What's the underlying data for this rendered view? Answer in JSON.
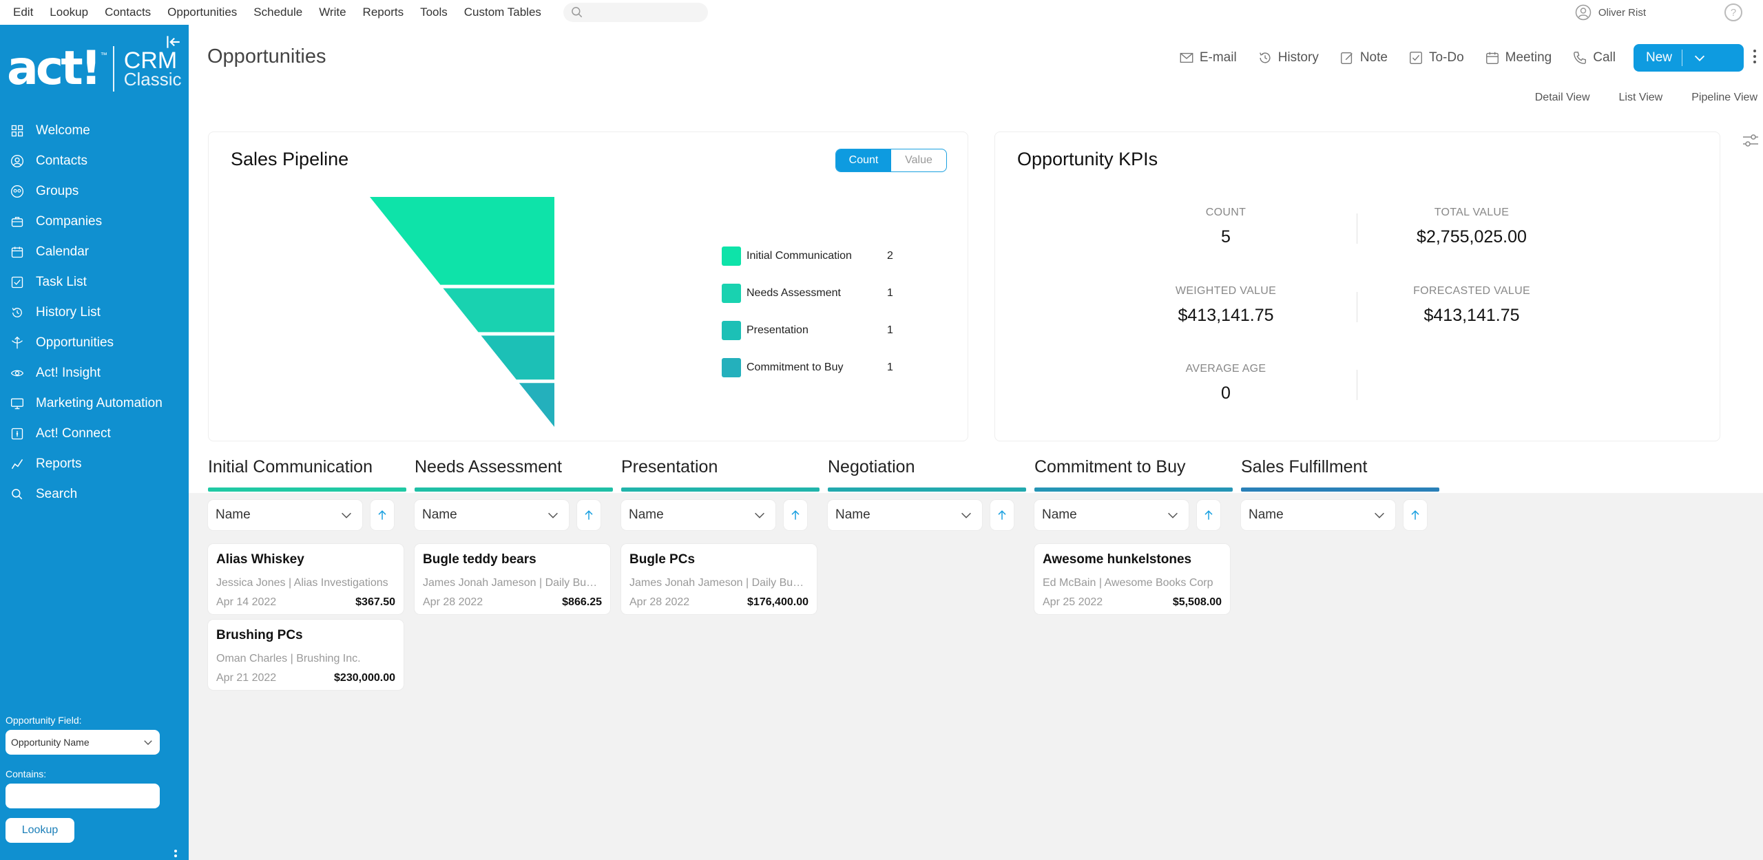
{
  "menubar": {
    "items": [
      "Edit",
      "Lookup",
      "Contacts",
      "Opportunities",
      "Schedule",
      "Write",
      "Reports",
      "Tools",
      "Custom Tables"
    ],
    "user_name": "Oliver Rist",
    "help_glyph": "?"
  },
  "sidebar": {
    "logo": {
      "brand": "act!",
      "tm": "™",
      "crm": "CRM",
      "classic": "Classic"
    },
    "items": [
      {
        "label": "Welcome",
        "icon": "grid-icon"
      },
      {
        "label": "Contacts",
        "icon": "contact-icon"
      },
      {
        "label": "Groups",
        "icon": "groups-icon"
      },
      {
        "label": "Companies",
        "icon": "briefcase-icon"
      },
      {
        "label": "Calendar",
        "icon": "calendar-icon"
      },
      {
        "label": "Task List",
        "icon": "checkbox-icon"
      },
      {
        "label": "History List",
        "icon": "history-icon"
      },
      {
        "label": "Opportunities",
        "icon": "opportunity-icon"
      },
      {
        "label": "Act! Insight",
        "icon": "eye-icon"
      },
      {
        "label": "Marketing Automation",
        "icon": "monitor-icon"
      },
      {
        "label": "Act! Connect",
        "icon": "connect-icon"
      },
      {
        "label": "Reports",
        "icon": "reports-icon"
      },
      {
        "label": "Search",
        "icon": "search-icon"
      }
    ],
    "lookup": {
      "field_label": "Opportunity Field:",
      "field_value": "Opportunity Name",
      "contains_label": "Contains:",
      "contains_value": "",
      "button_label": "Lookup"
    }
  },
  "header": {
    "title": "Opportunities",
    "actions": {
      "email": "E-mail",
      "history": "History",
      "note": "Note",
      "todo": "To-Do",
      "meeting": "Meeting",
      "call": "Call"
    },
    "new_label": "New",
    "views": {
      "detail": "Detail View",
      "list": "List View",
      "pipeline": "Pipeline View"
    }
  },
  "pipeline_card": {
    "title": "Sales Pipeline",
    "toggle": {
      "count": "Count",
      "value": "Value",
      "active": "count"
    },
    "legend": [
      {
        "name": "Initial Communication",
        "count": "2",
        "color": "#0ee3a9"
      },
      {
        "name": "Needs Assessment",
        "count": "1",
        "color": "#19d2b0"
      },
      {
        "name": "Presentation",
        "count": "1",
        "color": "#1cc0b6"
      },
      {
        "name": "Commitment to Buy",
        "count": "1",
        "color": "#24b0bc"
      }
    ]
  },
  "kpi_card": {
    "title": "Opportunity KPIs",
    "count_label": "COUNT",
    "count_value": "5",
    "total_label": "TOTAL VALUE",
    "total_value": "$2,755,025.00",
    "weighted_label": "WEIGHTED VALUE",
    "weighted_value": "$413,141.75",
    "forecast_label": "FORECASTED VALUE",
    "forecast_value": "$413,141.75",
    "age_label": "AVERAGE AGE",
    "age_value": "0"
  },
  "columns": [
    {
      "title": "Initial Communication",
      "bar_color": "#20c9a4",
      "sort": "Name",
      "cards": [
        {
          "name": "Alias Whiskey",
          "contact": "Jessica Jones | Alias Investigations",
          "date": "Apr 14 2022",
          "amount": "$367.50"
        },
        {
          "name": "Brushing PCs",
          "contact": "Oman Charles | Brushing Inc.",
          "date": "Apr 21 2022",
          "amount": "$230,000.00"
        }
      ]
    },
    {
      "title": "Needs Assessment",
      "bar_color": "#1fbfa6",
      "sort": "Name",
      "cards": [
        {
          "name": "Bugle teddy bears",
          "contact": "James Jonah Jameson | Daily Bugle",
          "date": "Apr 28 2022",
          "amount": "$866.25"
        }
      ]
    },
    {
      "title": "Presentation",
      "bar_color": "#21b4ab",
      "sort": "Name",
      "cards": [
        {
          "name": "Bugle PCs",
          "contact": "James Jonah Jameson | Daily Bugle",
          "date": "Apr 28 2022",
          "amount": "$176,400.00"
        }
      ]
    },
    {
      "title": "Negotiation",
      "bar_color": "#22a9ae",
      "sort": "Name",
      "cards": []
    },
    {
      "title": "Commitment to Buy",
      "bar_color": "#2595b5",
      "sort": "Name",
      "cards": [
        {
          "name": "Awesome hunkelstones",
          "contact": "Ed McBain | Awesome Books Corp",
          "date": "Apr 25 2022",
          "amount": "$5,508.00"
        }
      ]
    },
    {
      "title": "Sales Fulfillment",
      "bar_color": "#2a80b8",
      "sort": "Name",
      "cards": []
    }
  ]
}
